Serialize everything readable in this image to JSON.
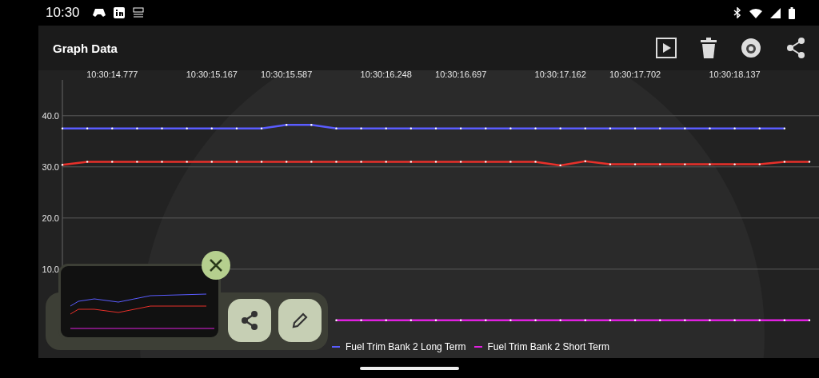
{
  "status_bar": {
    "time": "10:30"
  },
  "toolbar": {
    "title": "Graph Data"
  },
  "chart": {
    "chart_data": {
      "type": "line",
      "categories": [
        null,
        null,
        "10:30:14.777",
        null,
        null,
        null,
        "10:30:15.167",
        null,
        null,
        "10:30:15.587",
        null,
        null,
        null,
        "10:30:16.248",
        null,
        null,
        "10:30:16.697",
        null,
        null,
        null,
        "10:30:17.162",
        null,
        null,
        "10:30:17.702",
        null,
        null,
        null,
        "10:30:18.137",
        null,
        null,
        null
      ],
      "ylim": [
        -3,
        47
      ],
      "grid": true,
      "legend": true,
      "yticks": [
        {
          "value": 10,
          "label": "10.0"
        },
        {
          "value": 20,
          "label": "20.0"
        },
        {
          "value": 30,
          "label": "30.0"
        },
        {
          "value": 40,
          "label": "40.0"
        }
      ],
      "series": [
        {
          "name": "Fuel Trim Bank 2 Long Term",
          "color": "#5a5cff",
          "values": [
            37.5,
            37.5,
            37.5,
            37.5,
            37.5,
            37.5,
            37.5,
            37.5,
            37.5,
            38.2,
            38.2,
            37.5,
            37.5,
            37.5,
            37.5,
            37.5,
            37.5,
            37.5,
            37.5,
            37.5,
            37.5,
            37.5,
            37.5,
            37.5,
            37.5,
            37.5,
            37.5,
            37.5,
            37.5,
            37.5,
            null
          ]
        },
        {
          "color": "#e8302a",
          "values": [
            30.4,
            31,
            31,
            31,
            31,
            31,
            31,
            31,
            31,
            31,
            31,
            31,
            31,
            31,
            31,
            31,
            31,
            31,
            31,
            31,
            30.3,
            31.1,
            30.5,
            30.5,
            30.5,
            30.5,
            30.5,
            30.5,
            30.5,
            31,
            31
          ]
        },
        {
          "name": "Fuel Trim Bank 2 Short Term",
          "color": "#e020e0",
          "values": [
            null,
            null,
            null,
            null,
            null,
            null,
            null,
            null,
            null,
            null,
            null,
            0,
            0,
            0,
            0,
            0,
            0,
            0,
            0,
            0,
            0,
            0,
            0,
            0,
            0,
            0,
            0,
            0,
            0,
            0,
            0
          ]
        }
      ]
    }
  }
}
